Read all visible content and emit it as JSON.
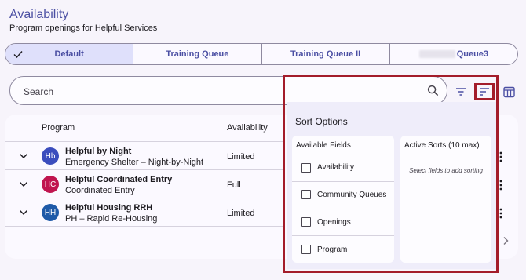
{
  "header": {
    "title": "Availability",
    "subtitle": "Program openings for Helpful Services"
  },
  "tabs": [
    {
      "label": "Default",
      "active": true
    },
    {
      "label": "Training Queue",
      "active": false
    },
    {
      "label": "Training Queue II",
      "active": false
    },
    {
      "label": "Queue3",
      "active": false
    }
  ],
  "search": {
    "placeholder": "Search"
  },
  "table": {
    "columns": [
      "Program",
      "Availability"
    ],
    "rows": [
      {
        "initials": "Hb",
        "avatar_color": "#3b4dbd",
        "name": "Helpful by Night",
        "type": "Emergency Shelter – Night-by-Night",
        "availability": "Limited"
      },
      {
        "initials": "HC",
        "avatar_color": "#c0154f",
        "name": "Helpful Coordinated Entry",
        "type": "Coordinated Entry",
        "availability": "Full"
      },
      {
        "initials": "HH",
        "avatar_color": "#1e5aa8",
        "name": "Helpful Housing RRH",
        "type": "PH – Rapid Re-Housing",
        "availability": "Limited"
      }
    ]
  },
  "sort_panel": {
    "title": "Sort Options",
    "available_header": "Available Fields",
    "active_header": "Active Sorts (10 max)",
    "active_hint": "Select fields to add sorting",
    "fields": [
      "Availability",
      "Community Queues",
      "Openings",
      "Program"
    ]
  },
  "colors": {
    "accent": "#4b4fa3",
    "highlight": "#a31c2a",
    "panel": "#efedfa"
  },
  "icons": [
    "check-icon",
    "search-icon",
    "filter-icon",
    "sort-icon",
    "columns-icon",
    "chevron-down-icon",
    "kebab-icon",
    "chevron-right-icon"
  ]
}
